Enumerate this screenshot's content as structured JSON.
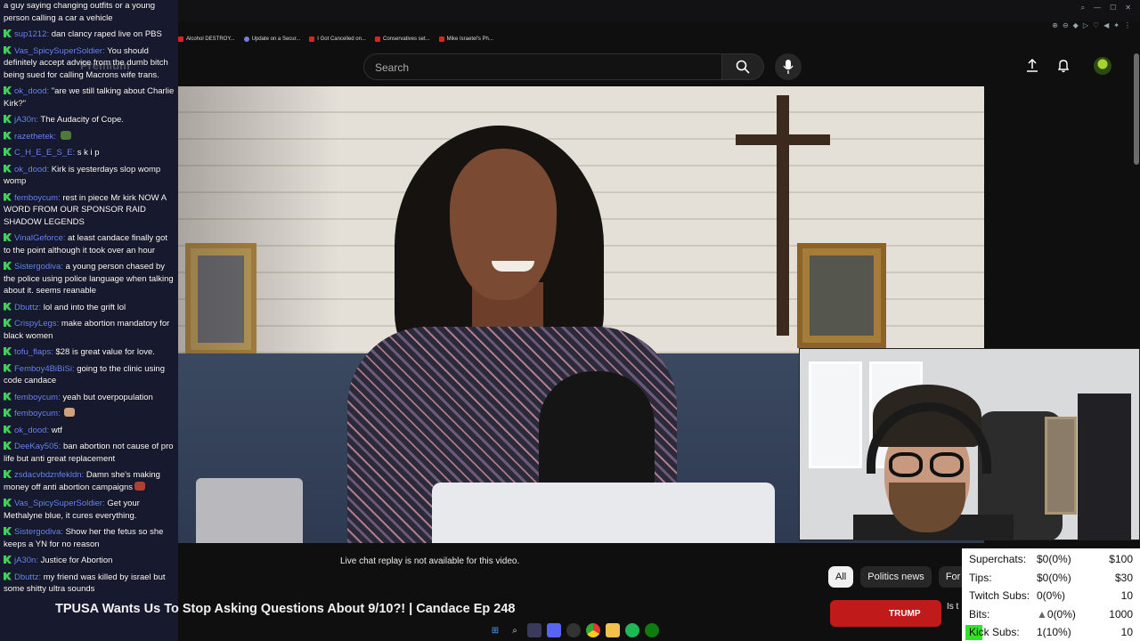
{
  "browser": {
    "tabs": [
      {
        "label": "Alcohol DESTROY..."
      },
      {
        "label": "Update on a Secur..."
      },
      {
        "label": "I Got Cancelled on..."
      },
      {
        "label": "Conservatives set..."
      },
      {
        "label": "Mike Israetel's Ph..."
      }
    ]
  },
  "youtube": {
    "search_placeholder": "Search",
    "premium_logo_text": "Premium",
    "live_chat_replay_note": "Live chat replay is not available for this video.",
    "video_title": "TPUSA Wants Us To Stop Asking Questions About 9/10?! | Candace Ep 248",
    "chips": [
      {
        "label": "All",
        "active": true
      },
      {
        "label": "Politics news",
        "active": false
      },
      {
        "label": "For",
        "active": false
      }
    ],
    "suggested_thumb_text": "TRUMP",
    "suggested_title_partial": "Is t"
  },
  "chat": {
    "messages": [
      {
        "user": "",
        "text": "a guy saying changing outfits or a young person calling a car a vehicle",
        "emote": ""
      },
      {
        "user": "sup1212",
        "text": "dan clancy raped live on PBS",
        "emote": ""
      },
      {
        "user": "Vas_SpicySuperSoldier",
        "text": "You should definitely accept advice from the dumb bitch being sued for calling Macrons wife trans.",
        "emote": ""
      },
      {
        "user": "ok_dood",
        "text": "\"are we still talking about Charlie Kirk?\"",
        "emote": ""
      },
      {
        "user": "jA30n",
        "text": "The Audacity of Cope.",
        "emote": ""
      },
      {
        "user": "razethetek",
        "text": "",
        "emote": "green"
      },
      {
        "user": "C_H_E_E_S_E",
        "text": "s k i p",
        "emote": ""
      },
      {
        "user": "ok_dood",
        "text": "Kirk is yesterdays slop womp womp",
        "emote": ""
      },
      {
        "user": "femboycum",
        "text": "rest in piece Mr kirk NOW A WORD FROM OUR SPONSOR RAID SHADOW LEGENDS",
        "emote": ""
      },
      {
        "user": "VinalGeforce",
        "text": "at least candace finally got to the point although it took over an hour",
        "emote": ""
      },
      {
        "user": "Sistergodiva",
        "text": "a young person chased by the police using police language when talking about it. seems reanable",
        "emote": ""
      },
      {
        "user": "Dbuttz",
        "text": "lol and into the grift lol",
        "emote": ""
      },
      {
        "user": "CrispyLegs",
        "text": "make abortion mandatory for black women",
        "emote": ""
      },
      {
        "user": "tofu_flaps",
        "text": "$28 is great value for love.",
        "emote": ""
      },
      {
        "user": "Femboy4BiBiSi",
        "text": "going to the clinic using code candace",
        "emote": ""
      },
      {
        "user": "femboycum",
        "text": "yeah but overpopulation",
        "emote": ""
      },
      {
        "user": "femboycum",
        "text": "",
        "emote": "skin"
      },
      {
        "user": "ok_dood",
        "text": "wtf",
        "emote": ""
      },
      {
        "user": "DeeKay505",
        "text": "ban abortion not cause of pro life but anti great replacement",
        "emote": ""
      },
      {
        "user": "zsdacvbdznfekldn",
        "text": "Damn she's making money off anti abortion campaigns",
        "emote": "red"
      },
      {
        "user": "Vas_SpicySuperSoldier",
        "text": "Get your Methalyne blue, it cures everything.",
        "emote": ""
      },
      {
        "user": "Sistergodiva",
        "text": "Show her the fetus so she keeps a YN for no reason",
        "emote": ""
      },
      {
        "user": "jA30n",
        "text": "Justice for Abortion",
        "emote": ""
      },
      {
        "user": "Dbuttz",
        "text": "my friend was killed by israel but some shitty ultra sounds",
        "emote": ""
      }
    ]
  },
  "stats": {
    "rows": [
      {
        "label": "Superchats:",
        "current": "$0(0%)",
        "goal": "$100",
        "progress": 0
      },
      {
        "label": "Tips:",
        "current": "$0(0%)",
        "goal": "$30",
        "progress": 0
      },
      {
        "label": "Twitch Subs:",
        "current": "0(0%)",
        "goal": "10",
        "progress": 0
      },
      {
        "label": "Bits:",
        "current": "0(0%)",
        "goal": "1000",
        "progress": 0
      },
      {
        "label": "Kick Subs:",
        "current": "1(10%)",
        "goal": "10",
        "progress": 0.1
      }
    ]
  },
  "colors": {
    "chat_username": "#6d8cff",
    "kick_green": "#33e02a",
    "chat_bg": "#181a30",
    "youtube_bg": "#0f0f0f"
  }
}
